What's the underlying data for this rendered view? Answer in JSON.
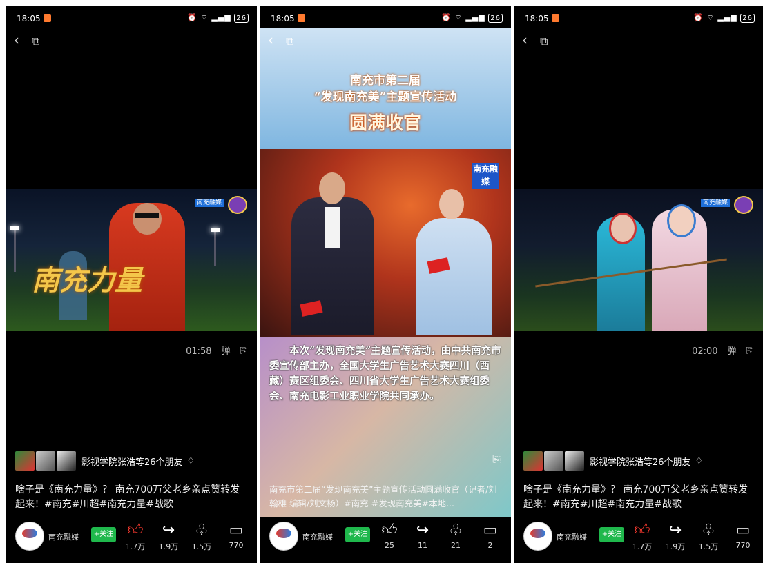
{
  "screens": [
    {
      "status": {
        "time": "18:05",
        "battery": "26"
      },
      "video_overlay_title": "南充力量",
      "time_label": "01:58",
      "danmaku_label": "弹",
      "friends_text": "影视学院张浩等26个朋友",
      "caption": "啥子是《南充力量》？ 南充700万父老乡亲点赞转发起来！#南充#川超#南充力量#战歌",
      "account": "南充融媒",
      "follow_label": "+关注",
      "actions": {
        "like": "1.7万",
        "share": "1.9万",
        "favorite": "1.5万",
        "comment": "770"
      },
      "watermark": "南充融媒"
    },
    {
      "status": {
        "time": "18:05",
        "battery": "26"
      },
      "banner": {
        "line1": "南充市第二届",
        "line2": "“发现南充美”主题宣传活动",
        "line3": "圆满收官"
      },
      "stage_watermark": "南充融媒",
      "info_text": "本次“发现南充美”主题宣传活动，由中共南充市委宣传部主办，全国大学生广告艺术大赛四川（西藏）赛区组委会、四川省大学生广告艺术大赛组委会、南充电影工业职业学院共同承办。",
      "caption": "南充市第二届“发现南充美”主题宣传活动圆满收官（记者/刘翰雄 编辑/刘文杨）#南充 #发现南充美#本地...",
      "account": "南充融媒",
      "follow_label": "+关注",
      "actions": {
        "like": "25",
        "share": "11",
        "favorite": "21",
        "comment": "2"
      }
    },
    {
      "status": {
        "time": "18:05",
        "battery": "26"
      },
      "time_label": "02:00",
      "danmaku_label": "弹",
      "friends_text": "影视学院张浩等26个朋友",
      "caption": "啥子是《南充力量》？ 南充700万父老乡亲点赞转发起来！#南充#川超#南充力量#战歌",
      "account": "南充融媒",
      "follow_label": "+关注",
      "actions": {
        "like": "1.7万",
        "share": "1.9万",
        "favorite": "1.5万",
        "comment": "770"
      },
      "watermark": "南充融媒"
    }
  ]
}
